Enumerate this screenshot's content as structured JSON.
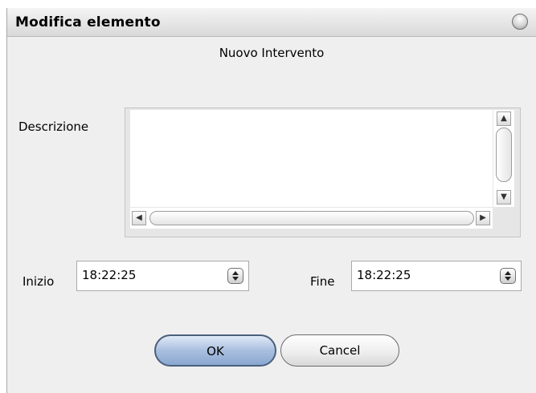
{
  "dialog": {
    "title": "Modifica elemento",
    "subtitle": "Nuovo Intervento"
  },
  "form": {
    "descrizione_label": "Descrizione",
    "descrizione_value": "",
    "inizio_label": "Inizio",
    "inizio_value": "18:22:25",
    "fine_label": "Fine",
    "fine_value": "18:22:25"
  },
  "buttons": {
    "ok_label": "OK",
    "cancel_label": "Cancel"
  },
  "icons": {
    "title_orb": "window-orb-icon",
    "scroll_up": "arrow-up-icon",
    "scroll_down": "arrow-down-icon",
    "scroll_left": "arrow-left-icon",
    "scroll_right": "arrow-right-icon",
    "spinner": "spinner-updown-icon"
  },
  "colors": {
    "ok_button": "#a9bfdf",
    "dialog_bg": "#efefef"
  }
}
